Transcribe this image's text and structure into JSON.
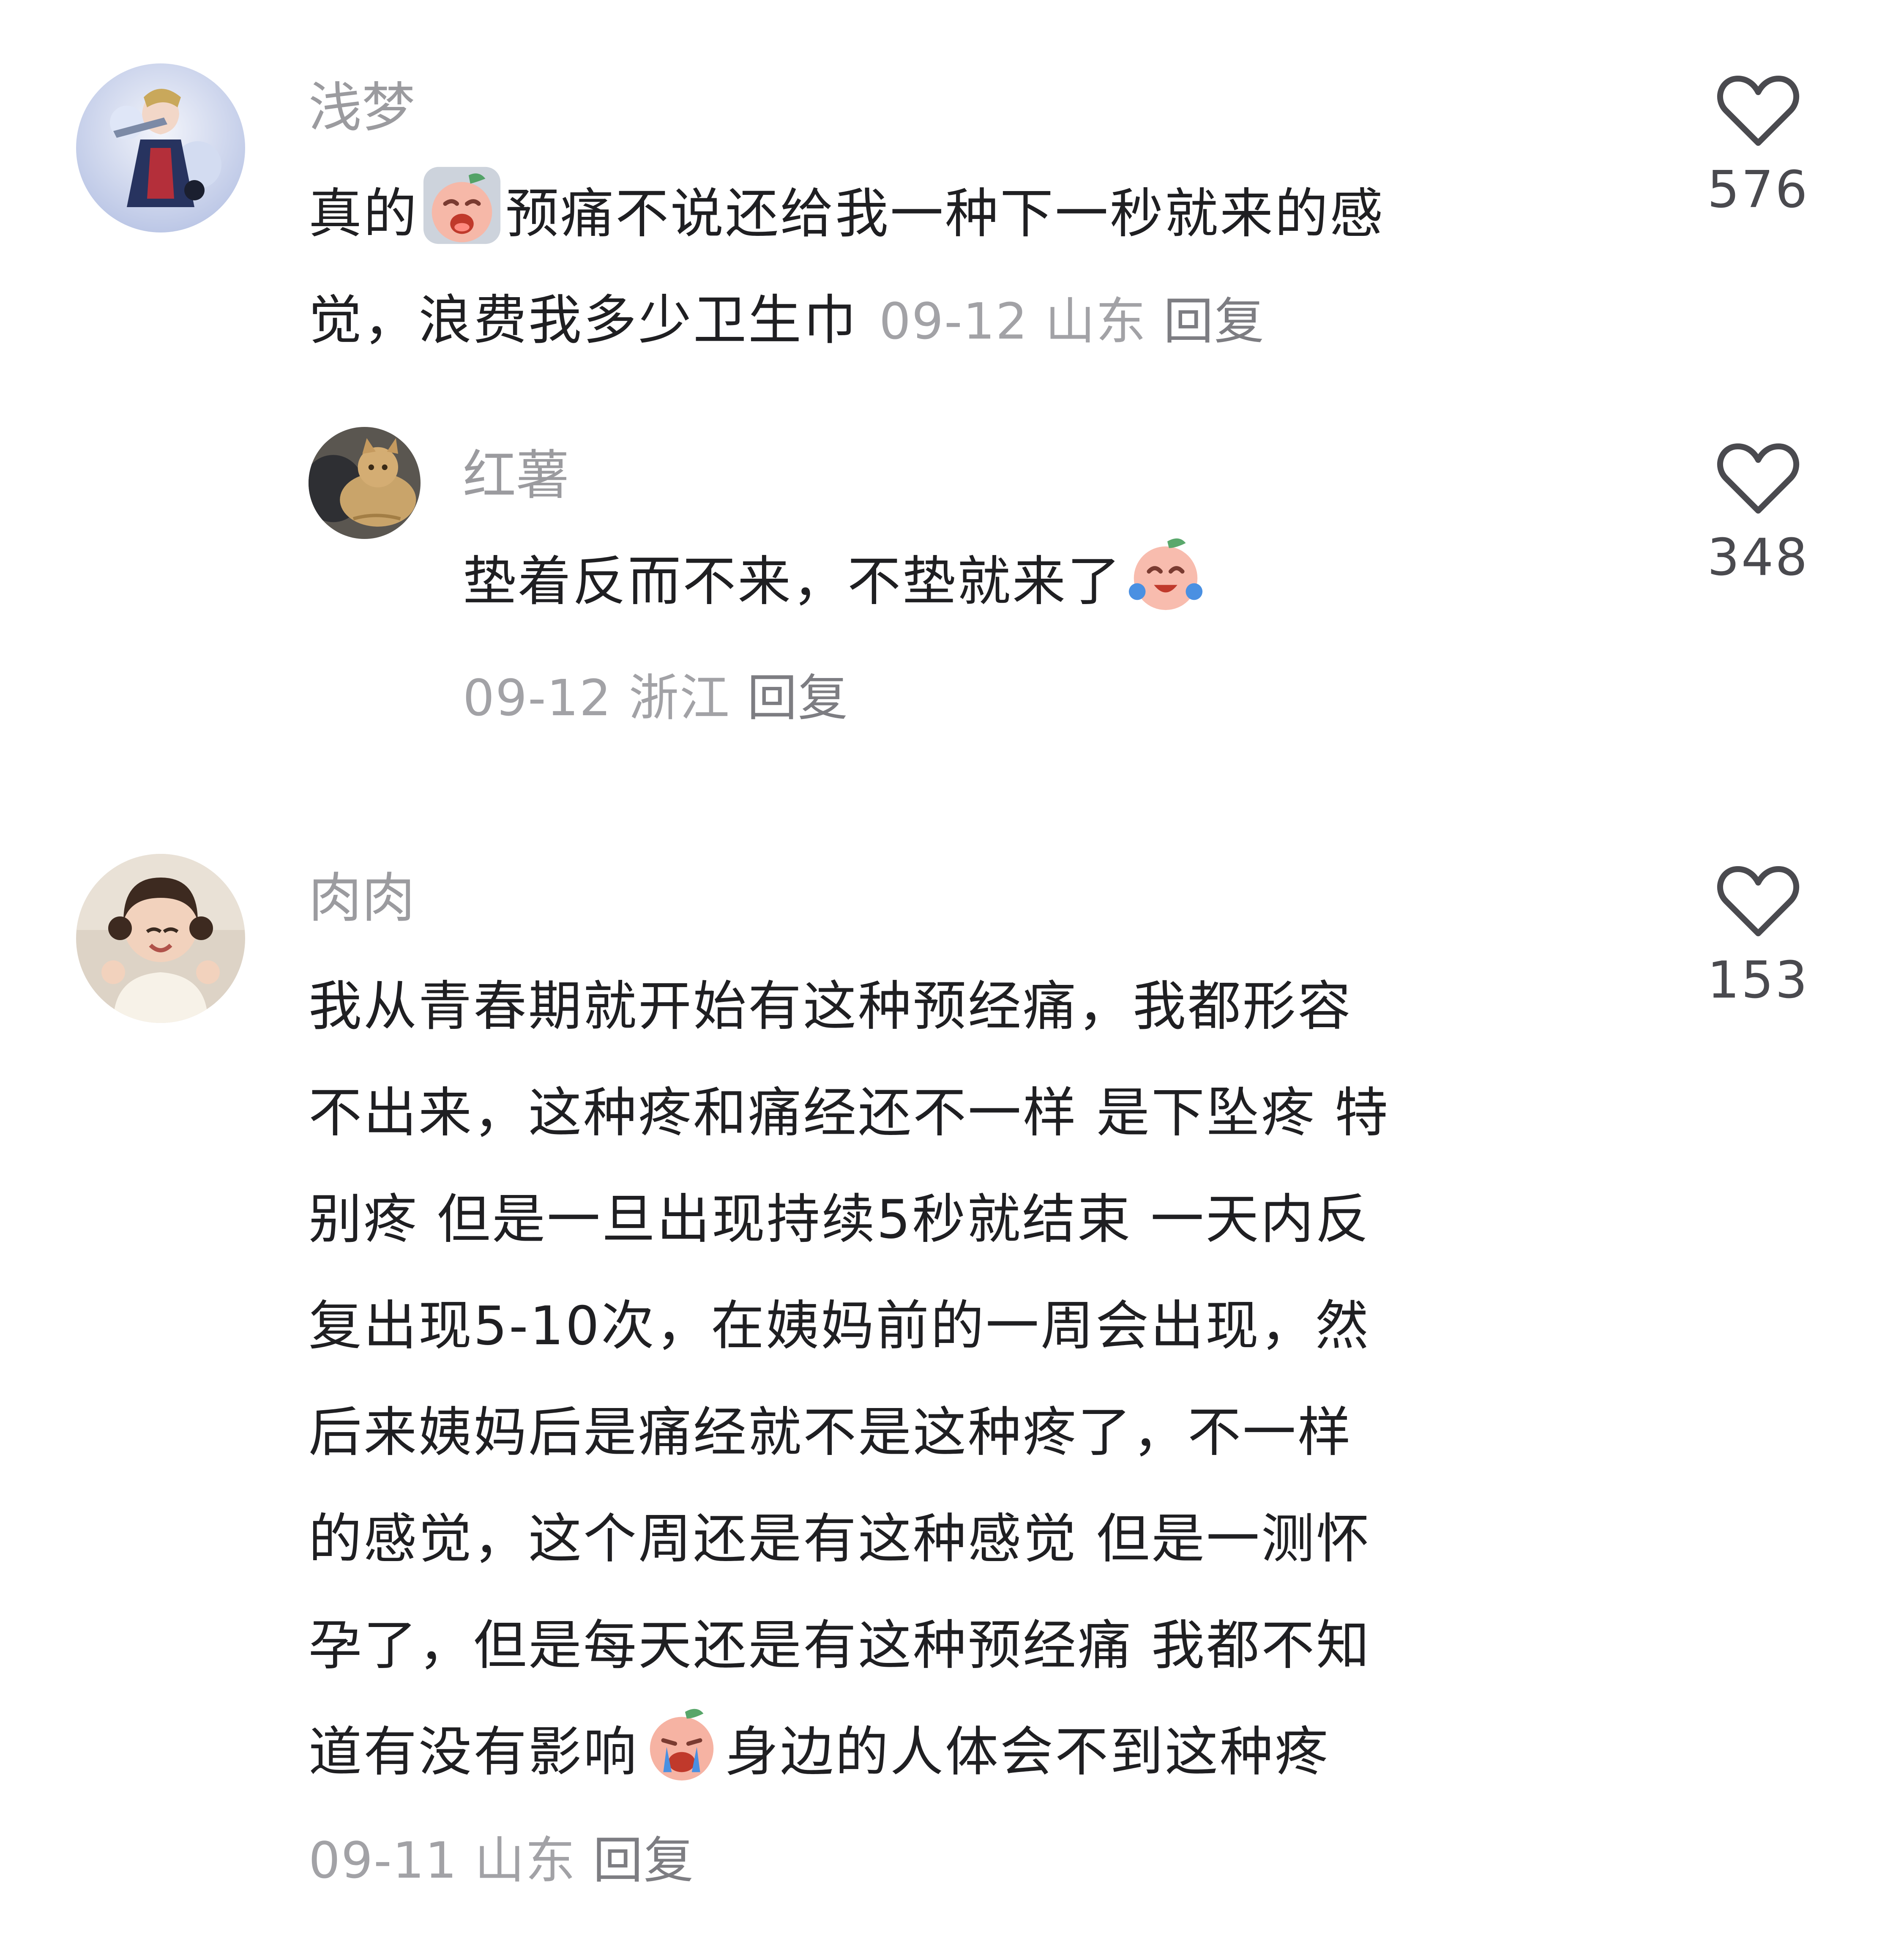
{
  "comments": [
    {
      "username": "浅梦",
      "text_lines": [
        [
          "真的",
          "预痛不说还给我一种下一秒就来的感"
        ],
        [
          "觉，浪费我多少卫生巾"
        ]
      ],
      "date": "09-12",
      "location": "山东",
      "reply_label": "回复",
      "likes": "576"
    },
    {
      "username": "红薯",
      "text_lines": [
        [
          "垫着反而不来，不垫就来了"
        ]
      ],
      "date": "09-12",
      "location": "浙江",
      "reply_label": "回复",
      "likes": "348"
    },
    {
      "username": "肉肉",
      "text_lines": [
        [
          "我从青春期就开始有这种预经痛，我都形容"
        ],
        [
          "不出来，这种疼和痛经还不一样 是下坠疼 特"
        ],
        [
          "别疼 但是一旦出现持续5秒就结束  一天内反"
        ],
        [
          "复出现5-10次，在姨妈前的一周会出现，然"
        ],
        [
          "后来姨妈后是痛经就不是这种疼了，不一样"
        ],
        [
          "的感觉，这个周还是有这种感觉 但是一测怀"
        ],
        [
          "孕了，但是每天还是有这种预经痛 我都不知"
        ],
        [
          "道有没有影响",
          "身边的人体会不到这种疼"
        ]
      ],
      "date": "09-11",
      "location": "山东",
      "reply_label": "回复",
      "likes": "153"
    }
  ],
  "icons": {
    "like": "heart-outline-icon",
    "emoji_1": "crying-peach-emoji-icon",
    "emoji_2": "laughing-tears-peach-emoji-icon",
    "emoji_3": "sobbing-peach-emoji-icon"
  },
  "colors": {
    "username": "#9b9b9f",
    "text": "#1f1f22",
    "meta": "#a2a2a6",
    "reply": "#7d7d82",
    "like_icon": "#4a4a4f"
  }
}
